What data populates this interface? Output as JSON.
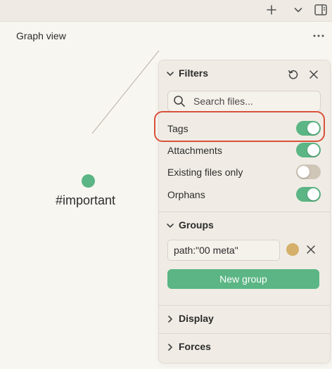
{
  "toolbar": {
    "new_tab_icon": "plus-icon",
    "dropdown_icon": "chevron-down-icon",
    "sidebar_icon": "sidebar-toggle-icon"
  },
  "view": {
    "title": "Graph view",
    "more_icon": "more-horizontal-icon"
  },
  "graph": {
    "node_label": "#important",
    "node_color": "#5bb584"
  },
  "filters": {
    "title": "Filters",
    "restore_icon": "restore-icon",
    "close_icon": "close-icon",
    "search": {
      "placeholder": "Search files...",
      "value": ""
    },
    "toggles": [
      {
        "label": "Tags",
        "on": true
      },
      {
        "label": "Attachments",
        "on": true
      },
      {
        "label": "Existing files only",
        "on": false
      },
      {
        "label": "Orphans",
        "on": true
      }
    ]
  },
  "groups": {
    "title": "Groups",
    "items": [
      {
        "query": "path:\"00 meta\"",
        "color": "#d4b06a"
      }
    ],
    "new_group_label": "New group"
  },
  "display": {
    "title": "Display"
  },
  "forces": {
    "title": "Forces"
  },
  "colors": {
    "accent": "#5bb584",
    "toggle_off": "#cfc6b8",
    "highlight": "#d9513a"
  }
}
